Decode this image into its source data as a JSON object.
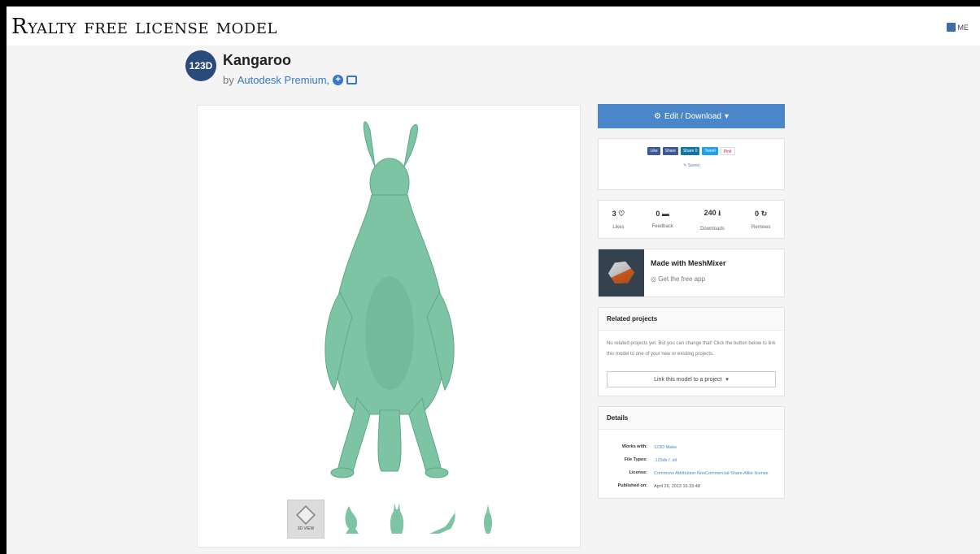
{
  "slide_title": "Ryalty free license model",
  "topbar": {
    "user_label": "ME"
  },
  "project": {
    "logo_text": "123D",
    "title": "Kangaroo",
    "by_prefix": "by",
    "author": "Autodesk Premium,"
  },
  "thumbnails": {
    "first_label": "3D VIEW"
  },
  "sidebar": {
    "edit_button": "Edit / Download",
    "share": {
      "buttons": [
        "Like",
        "Share",
        "Share 0",
        "Tweet",
        "Pinit"
      ],
      "saved": "Saved"
    },
    "stats": [
      {
        "value": "3",
        "label": "Likes"
      },
      {
        "value": "0",
        "label": "Feedback"
      },
      {
        "value": "240",
        "label": "Downloads"
      },
      {
        "value": "0",
        "label": "Remixes"
      }
    ],
    "meshmixer": {
      "title": "Made with MeshMixer",
      "subtitle": "Get the free app"
    },
    "related": {
      "heading": "Related projects",
      "body": "No related projects yet. But you can change that! Click the button below to link this model to one of your new or existing projects.",
      "link_button": "Link this model to a project"
    },
    "details": {
      "heading": "Details",
      "rows": [
        {
          "key": "Works with:",
          "value": "123D Make"
        },
        {
          "key": "File Types:",
          "value": ".123dx / .stl"
        },
        {
          "key": "License:",
          "value": "Commons Attribution-NonCommercial-Share Alike license"
        },
        {
          "key": "Published on:",
          "value": "April 26, 2013 16:33:48"
        }
      ]
    }
  },
  "colors": {
    "accent": "#4a86c8",
    "model": "#7dc4a4"
  }
}
